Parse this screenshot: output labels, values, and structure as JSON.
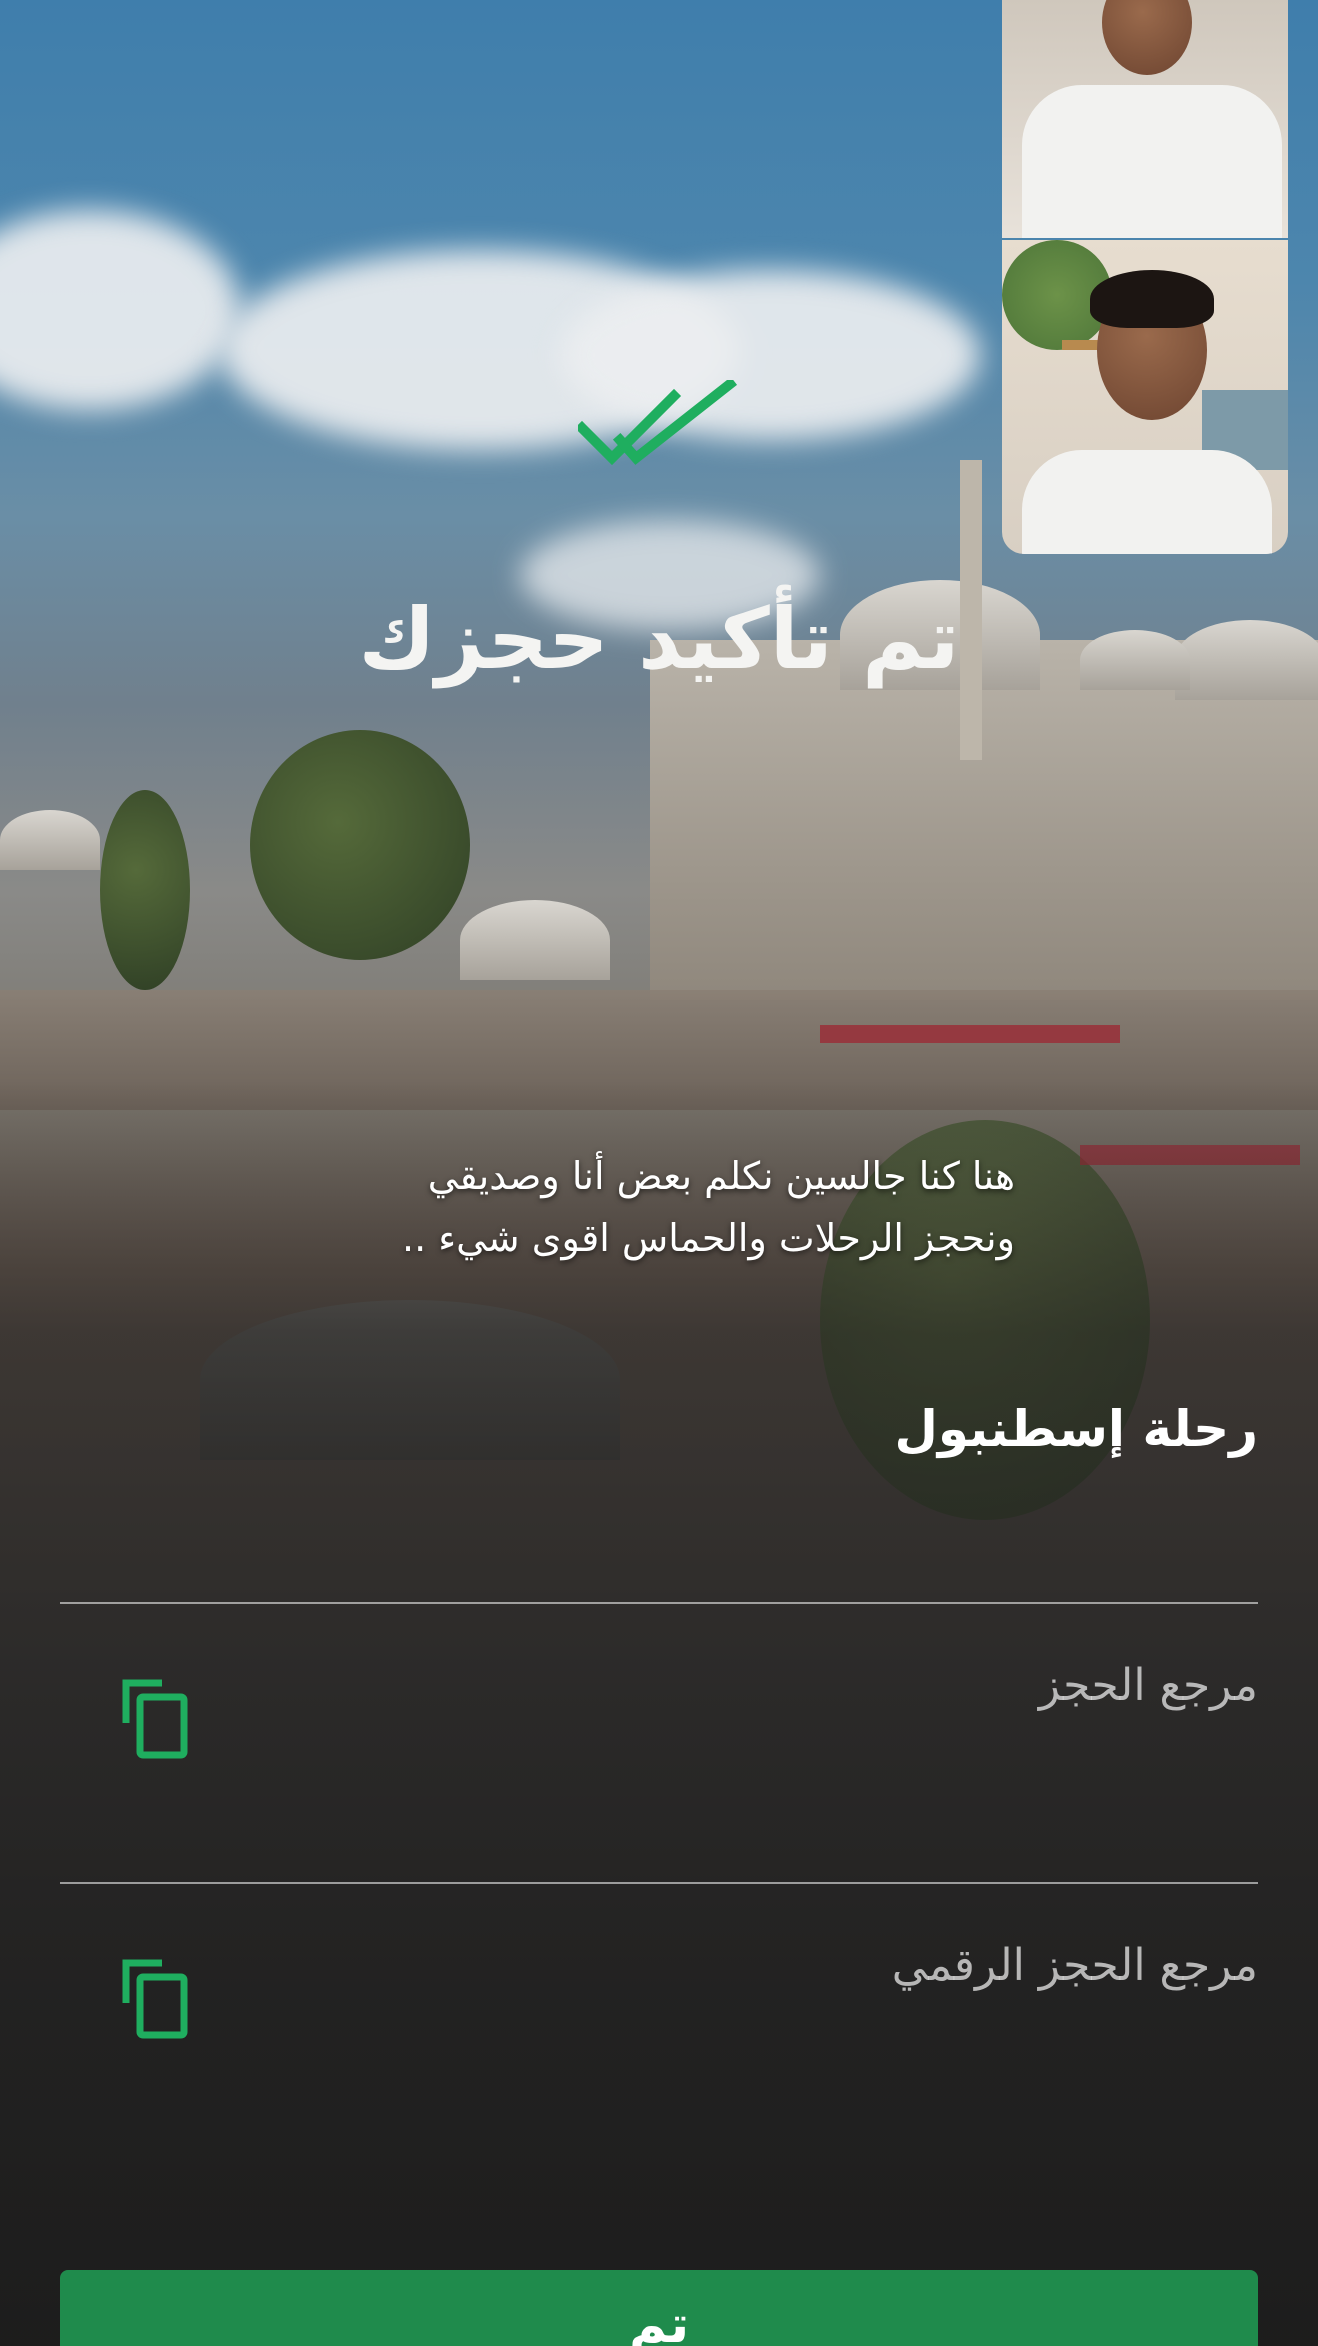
{
  "confirmation": {
    "title": "تم تأكيد حجزك",
    "check_icon": "double-check-icon",
    "accent_color": "#1fae5f"
  },
  "caption": {
    "line1": "هنا كنا جالسين نكلم بعض أنا وصديقي",
    "line2": "ونحجز الرحلات والحماس اقوى شيء .."
  },
  "trip": {
    "name": "رحلة إسطنبول"
  },
  "fields": [
    {
      "label": "مرجع الحجز",
      "icon": "copy-icon"
    },
    {
      "label": "مرجع الحجز الرقمي",
      "icon": "copy-icon"
    }
  ],
  "actions": {
    "done_label": "تم",
    "button_color": "#1f8b4c"
  }
}
